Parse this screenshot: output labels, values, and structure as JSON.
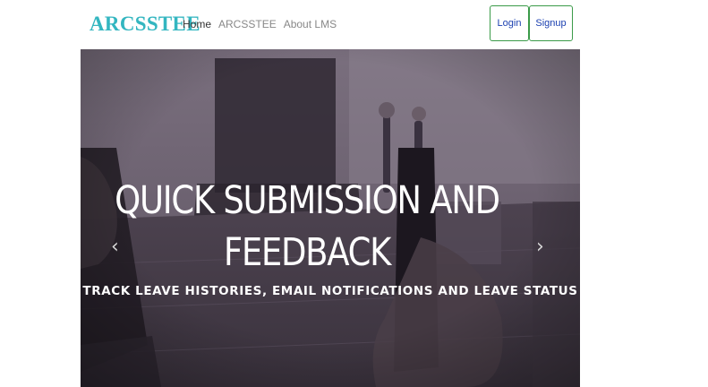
{
  "navbar": {
    "brand": "ARCSSTEE",
    "links": [
      {
        "label": "Home"
      },
      {
        "label": "ARCSSTEE"
      },
      {
        "label": "About LMS"
      }
    ],
    "login_label": "Login",
    "signup_label": "Signup"
  },
  "carousel": {
    "title_line1": "QUICK SUBMISSION AND",
    "title_line2": "FEEDBACK",
    "subtitle": "TRACK LEAVE HISTORIES, EMAIL NOTIFICATIONS AND LEAVE STATUS",
    "prev_icon": "‹",
    "next_icon": "›"
  },
  "colors": {
    "brand": "#33b6c0",
    "button_border": "#3a9a48",
    "button_text": "#1a3fb0",
    "overlay": "#4f4452"
  }
}
